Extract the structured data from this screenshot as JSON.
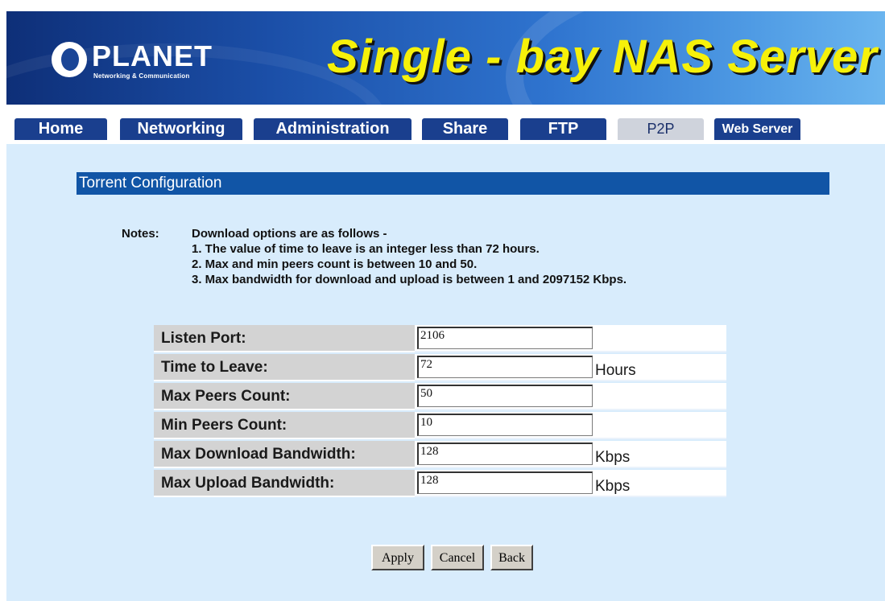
{
  "brand": {
    "logo_text": "PLANET",
    "logo_tagline": "Networking & Communication",
    "title": "Single - bay NAS Server"
  },
  "tabs": [
    {
      "label": "Home",
      "active": false
    },
    {
      "label": "Networking",
      "active": false
    },
    {
      "label": "Administration",
      "active": false
    },
    {
      "label": "Share",
      "active": false
    },
    {
      "label": "FTP",
      "active": false
    },
    {
      "label": "P2P",
      "active": true
    },
    {
      "label": "Web Server",
      "active": false
    }
  ],
  "section_title": "Torrent Configuration",
  "notes": {
    "label": "Notes:",
    "lines": [
      "Download options are as follows -",
      "1. The value of time to leave is an integer less than 72 hours.",
      "2. Max and min peers count is between 10 and 50.",
      "3. Max bandwidth for download and upload is between 1 and 2097152 Kbps."
    ]
  },
  "form": {
    "rows": [
      {
        "label": "Listen Port:",
        "value": "2106",
        "unit": ""
      },
      {
        "label": "Time to Leave:",
        "value": "72",
        "unit": "Hours"
      },
      {
        "label": "Max Peers Count:",
        "value": "50",
        "unit": ""
      },
      {
        "label": "Min Peers Count:",
        "value": "10",
        "unit": ""
      },
      {
        "label": "Max Download Bandwidth:",
        "value": "128",
        "unit": "Kbps"
      },
      {
        "label": "Max Upload Bandwidth:",
        "value": "128",
        "unit": "Kbps"
      }
    ]
  },
  "buttons": {
    "apply": "Apply",
    "cancel": "Cancel",
    "back": "Back"
  },
  "colors": {
    "banner_dark": "#0e2f78",
    "tab_bg": "#1a3f8e",
    "section_bar": "#1155a6",
    "content_bg": "#d8ecfc",
    "title_yellow": "#f6f10a"
  }
}
